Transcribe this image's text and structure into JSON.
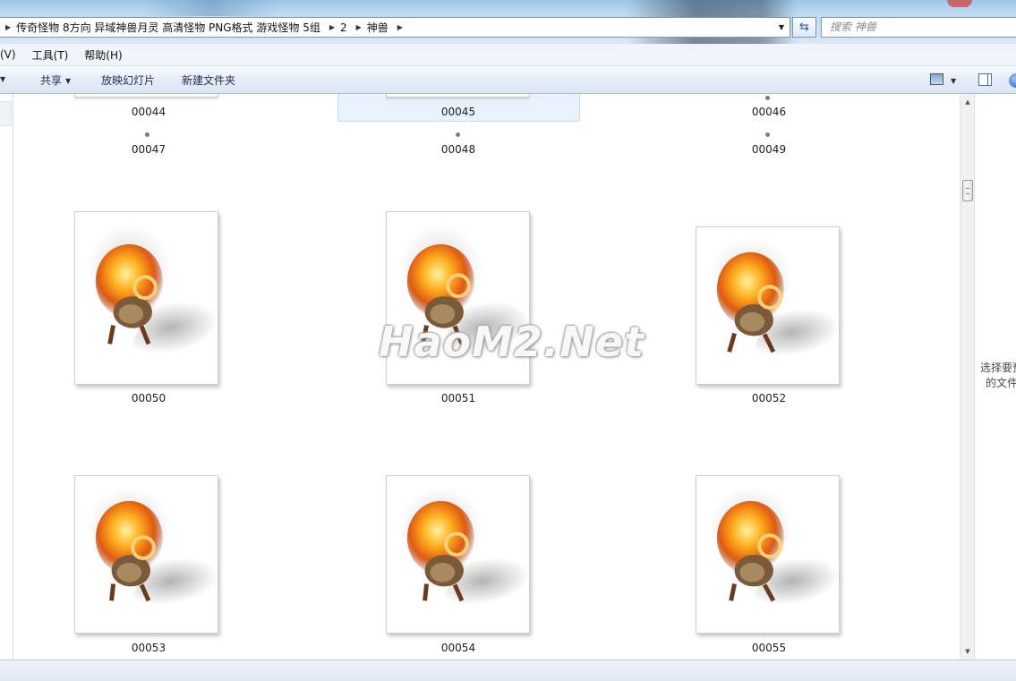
{
  "window": {
    "address": {
      "crumbs": [
        "传奇怪物 8方向 异域神兽月灵 高清怪物 PNG格式 游戏怪物 5组",
        "2",
        "神兽"
      ],
      "dropdown_icon": "chevron-down-icon"
    },
    "refresh_icon": "refresh-icon",
    "search": {
      "placeholder": "搜索 神兽"
    }
  },
  "menu": {
    "items": [
      "(V)",
      "工具(T)",
      "帮助(H)"
    ]
  },
  "toolbar": {
    "share_label": "共享",
    "slideshow_label": "放映幻灯片",
    "new_folder_label": "新建文件夹",
    "view_icon": "view-options-icon",
    "pane_icon": "preview-pane-icon",
    "help_icon": "help-icon"
  },
  "files": {
    "top_partial": [
      "00044",
      "00045",
      "00046"
    ],
    "tiny_row": [
      "00047",
      "00048",
      "00049"
    ],
    "row1": [
      "00050",
      "00051",
      "00052"
    ],
    "row2": [
      "00053",
      "00054",
      "00055"
    ],
    "selected": "00045"
  },
  "watermark": "HaoM2.Net",
  "preview": {
    "line1": "选择要预",
    "line2": "的文件"
  }
}
